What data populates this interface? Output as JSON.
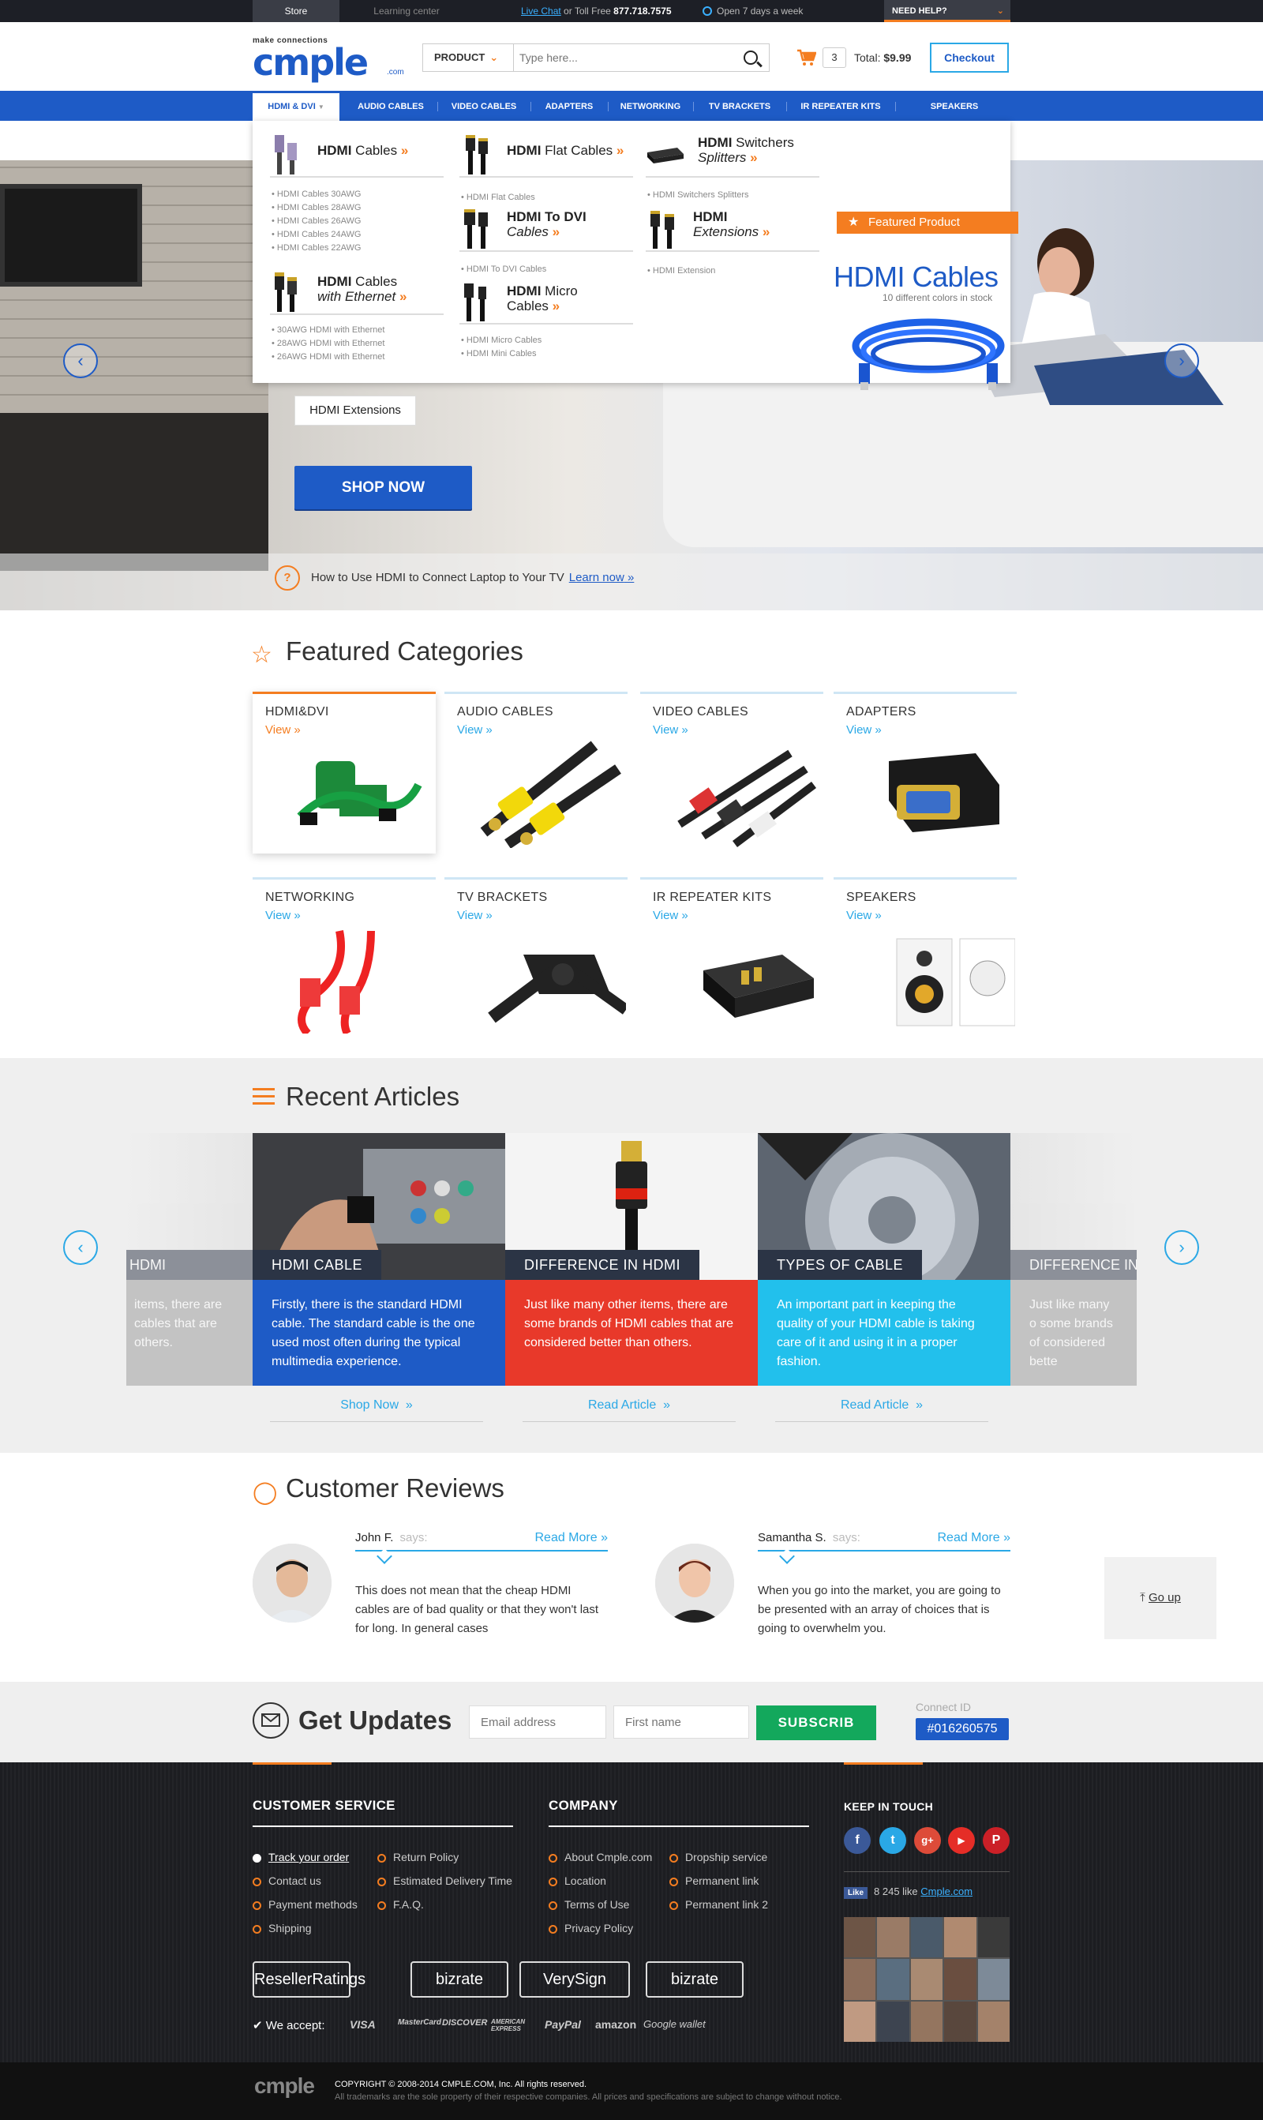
{
  "topbar": {
    "store": "Store",
    "learning": "Learning center",
    "live_chat": "Live Chat",
    "or_toll_free": " or Toll Free ",
    "phone": "877.718.7575",
    "open": "Open 7 days a week",
    "need_help": "NEED HELP?"
  },
  "header": {
    "logo_tagline": "make connections",
    "logo_word": "cmple",
    "logo_com": ".com",
    "search_category": "PRODUCT",
    "search_placeholder": "Type here...",
    "cart_count": "3",
    "total_label": "Total: ",
    "total_value": "$9.99",
    "checkout": "Checkout"
  },
  "nav": {
    "items": [
      "HDMI & DVI",
      "AUDIO CABLES",
      "VIDEO CABLES",
      "ADAPTERS",
      "NETWORKING",
      "TV BRACKETS",
      "IR REPEATER KITS",
      "SPEAKERS"
    ]
  },
  "mega": {
    "c1": {
      "title_b": "HDMI",
      "title_r": " Cables",
      "links": [
        "HDMI Cables 30AWG",
        "HDMI Cables 28AWG",
        "HDMI Cables 26AWG",
        "HDMI Cables 24AWG",
        "HDMI Cables 22AWG"
      ],
      "title2_b": "HDMI",
      "title2_r": " Cables",
      "title2_i": "with Ethernet",
      "links2": [
        "30AWG HDMI with Ethernet",
        "28AWG HDMI with Ethernet",
        "26AWG HDMI with Ethernet"
      ]
    },
    "c2": {
      "t1_b": "HDMI",
      "t1_r": " Flat Cables",
      "l1": "HDMI Flat Cables",
      "t2_b": "HDMI To DVI",
      "t2_i": "Cables",
      "l2": "HDMI To DVI Cables",
      "t3_b": "HDMI",
      "t3_r": " Micro",
      "t3_r2": "Cables",
      "l3a": "HDMI Micro Cables",
      "l3b": "HDMI Mini Cables"
    },
    "c3": {
      "t1_b": "HDMI",
      "t1_r": " Switchers",
      "t1_i": "Splitters",
      "l1": "HDMI Switchers Splitters",
      "t2_b": "HDMI",
      "t2_i": "Extensions",
      "l2": "HDMI Extension"
    },
    "featured_tag": "Featured Product",
    "featured_title": "HDMI Cables",
    "featured_sub": "10 different colors in stock"
  },
  "hero": {
    "extensions": "HDMI Extensions",
    "shop_now": "SHOP NOW",
    "howto": "How to Use HDMI to Connect Laptop to Your TV",
    "learn": "Learn now"
  },
  "categories": {
    "title": "Featured Categories",
    "view": "View",
    "items": [
      "HDMI&DVI",
      "AUDIO CABLES",
      "VIDEO CABLES",
      "ADAPTERS",
      "NETWORKING",
      "TV BRACKETS",
      "IR REPEATER KITS",
      "SPEAKERS"
    ]
  },
  "articles": {
    "title": "Recent Articles",
    "items": [
      {
        "label": "HDMI CABLE",
        "text": "Firstly, there is the standard HDMI cable. The standard cable is the one used most often during the typical multimedia experience.",
        "link": "Shop Now",
        "color": "#1e5bc6"
      },
      {
        "label": "DIFFERENCE IN HDMI",
        "text": "Just like many other items, there are some brands of HDMI cables that are considered better than others.",
        "link": "Read Article",
        "color": "#e8392a"
      },
      {
        "label": "TYPES OF CABLE",
        "text": "An important part in keeping the quality of your HDMI cable is taking care of it and using it in a proper fashion.",
        "link": "Read Article",
        "color": "#22c0ec"
      }
    ],
    "ghost_left_label": "HDMI",
    "ghost_left_text": "items, there are cables that are others.",
    "ghost_right_label": "DIFFERENCE IN",
    "ghost_right_text": "Just like many o some brands of considered bette"
  },
  "reviews": {
    "title": "Customer Reviews",
    "says": "says:",
    "read_more": "Read More",
    "items": [
      {
        "name": "John F.",
        "text": "This does not mean that the cheap HDMI cables are of bad quality or that they won't last for long. In general cases"
      },
      {
        "name": "Samantha S.",
        "text": "When you go into the market, you are going to be presented with an array of choices that is going to overwhelm you."
      }
    ],
    "go_up": "Go up"
  },
  "updates": {
    "title": "Get Updates",
    "email_placeholder": "Email address",
    "name_placeholder": "First name",
    "subscribe": "SUBSCRIB",
    "connect_label": "Connect ID",
    "connect_id": "#016260575"
  },
  "footer": {
    "cs_title": "CUSTOMER SERVICE",
    "cs_col1": [
      "Track your order",
      "Contact us",
      "Payment methods",
      "Shipping"
    ],
    "cs_col2": [
      "Return Policy",
      "Estimated Delivery Time",
      "F.A.Q."
    ],
    "co_title": "COMPANY",
    "co_col1": [
      "About Cmple.com",
      "Location",
      "Terms of Use",
      "Privacy Policy"
    ],
    "co_col2": [
      "Dropship service",
      "Permanent link",
      "Permanent link 2"
    ],
    "kit_title": "KEEP IN TOUCH",
    "fb_like": "Like",
    "fb_count": "8 245 like",
    "fb_site": "Cmple.com",
    "badges": [
      "ResellerRatings",
      "bizrate",
      "VerySign",
      "bizrate"
    ],
    "we_accept": "We accept:",
    "payments": [
      "VISA",
      "MasterCard",
      "DISCOVER",
      "AMERICAN EXPRESS",
      "PayPal",
      "amazon",
      "Google wallet"
    ],
    "copyright": "COPYRIGHT © 2008-2014 CMPLE.COM, Inc. All rights reserved.",
    "trademark": "All trademarks are the sole property of their respective companies. All prices and specifications are subject to change without notice.",
    "bottom_logo": "cmple"
  },
  "colors": {
    "brand": "#1e5bc6",
    "accent": "#f47d20",
    "cyan": "#2aa8e6",
    "green": "#13a85c"
  }
}
